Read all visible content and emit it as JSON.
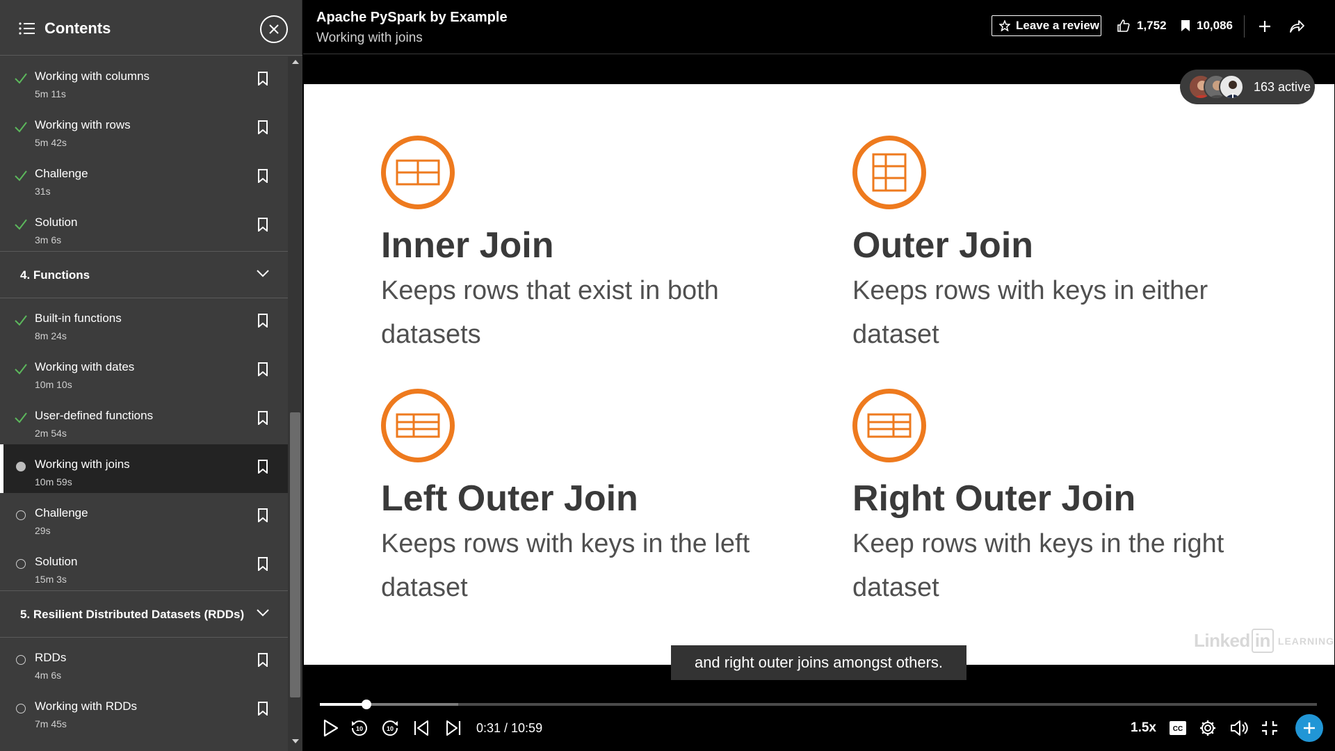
{
  "sidebar": {
    "title": "Contents",
    "items_top": [
      {
        "label": "Working with columns",
        "duration": "5m 11s"
      },
      {
        "label": "Working with rows",
        "duration": "5m 42s"
      },
      {
        "label": "Challenge",
        "duration": "31s"
      },
      {
        "label": "Solution",
        "duration": "3m 6s"
      }
    ],
    "section4": {
      "title": "4. Functions",
      "items": [
        {
          "label": "Built-in functions",
          "duration": "8m 24s"
        },
        {
          "label": "Working with dates",
          "duration": "10m 10s"
        },
        {
          "label": "User-defined functions",
          "duration": "2m 54s"
        },
        {
          "label": "Working with joins",
          "duration": "10m 59s"
        },
        {
          "label": "Challenge",
          "duration": "29s"
        },
        {
          "label": "Solution",
          "duration": "15m 3s"
        }
      ]
    },
    "section5": {
      "title": "5. Resilient Distributed Datasets (RDDs)",
      "items": [
        {
          "label": "RDDs",
          "duration": "4m 6s"
        },
        {
          "label": "Working with RDDs",
          "duration": "7m 45s"
        }
      ]
    }
  },
  "topbar": {
    "course_title": "Apache PySpark by Example",
    "video_title": "Working with joins",
    "review_label": "Leave a review",
    "likes": "1,752",
    "saves": "10,086"
  },
  "video": {
    "active_count": "163 active",
    "caption": "and right outer joins amongst others.",
    "time": "0:31 / 10:59",
    "speed": "1.5x",
    "progress_fraction": 0.047,
    "buffer_fraction": 0.139,
    "watermark": {
      "left": "Linked",
      "in": "in",
      "right": "LEARNING"
    },
    "slide": {
      "inner_title": "Inner Join",
      "inner_desc": "Keeps rows that exist in both datasets",
      "outer_title": "Outer Join",
      "outer_desc": "Keeps rows with keys in either dataset",
      "left_title": "Left Outer Join",
      "left_desc": "Keeps rows with keys in the left dataset",
      "right_title": "Right Outer Join",
      "right_desc": "Keep rows with keys in the right dataset"
    }
  },
  "colors": {
    "accent_orange": "#ee7a1e",
    "check_green": "#5cb85c",
    "cta_blue": "#2196d6"
  }
}
